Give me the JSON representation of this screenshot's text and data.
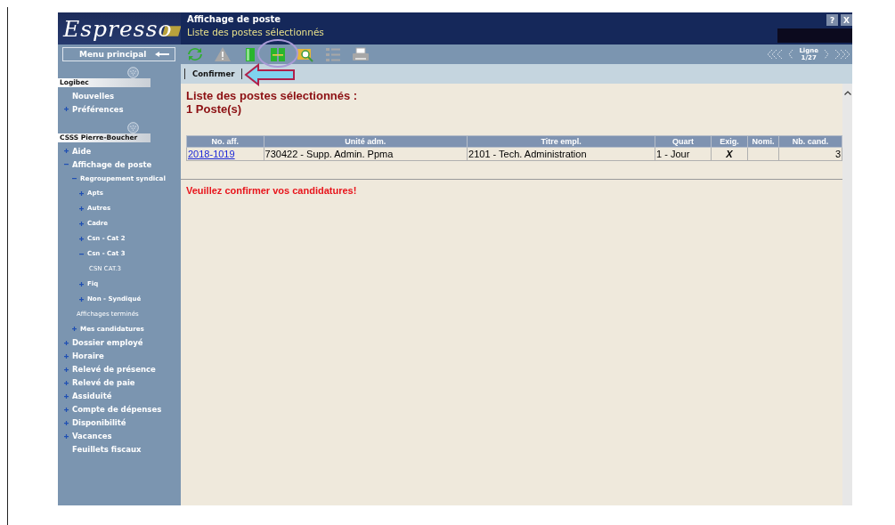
{
  "header": {
    "logo": "Espresso",
    "title": "Affichage de poste",
    "subtitle": "Liste des postes sélectionnés",
    "help": "?",
    "close": "X"
  },
  "menu_button": "Menu principal",
  "toolbar": [
    {
      "kind": "refresh",
      "disabled": false
    },
    {
      "kind": "warning",
      "disabled": true
    },
    {
      "kind": "panel",
      "disabled": false
    },
    {
      "kind": "split",
      "disabled": false
    },
    {
      "kind": "search",
      "disabled": false
    },
    {
      "kind": "list",
      "disabled": true
    },
    {
      "kind": "print",
      "disabled": true
    }
  ],
  "pager": {
    "label": "Ligne",
    "position": "1/27"
  },
  "command_bar": [
    "Confirmer"
  ],
  "sidebar": {
    "sections": [
      {
        "title": "Logibec",
        "items": [
          {
            "label": "Nouvelles",
            "kind": "link"
          },
          {
            "label": "Préférences",
            "kind": "folder",
            "expanded": false
          }
        ]
      },
      {
        "title": "CSSS Pierre-Boucher",
        "items": [
          {
            "label": "Aide",
            "kind": "folder",
            "expanded": false
          },
          {
            "label": "Affichage de poste",
            "kind": "folder",
            "expanded": true,
            "children": [
              {
                "label": "Regroupement syndical",
                "kind": "folder",
                "expanded": true,
                "children": [
                  {
                    "label": "Apts",
                    "kind": "folder",
                    "expanded": false
                  },
                  {
                    "label": "Autres",
                    "kind": "folder",
                    "expanded": false
                  },
                  {
                    "label": "Cadre",
                    "kind": "folder",
                    "expanded": false
                  },
                  {
                    "label": "Csn - Cat 2",
                    "kind": "folder",
                    "expanded": false
                  },
                  {
                    "label": "Csn - Cat 3",
                    "kind": "folder",
                    "expanded": true,
                    "children": [
                      {
                        "label": "CSN CAT.3",
                        "kind": "link"
                      }
                    ]
                  },
                  {
                    "label": "Fiq",
                    "kind": "folder",
                    "expanded": false
                  },
                  {
                    "label": "Non - Syndiqué",
                    "kind": "folder",
                    "expanded": false
                  }
                ]
              },
              {
                "label": "Affichages terminés",
                "kind": "link"
              },
              {
                "label": "Mes candidatures",
                "kind": "folder",
                "expanded": false
              }
            ]
          },
          {
            "label": "Dossier employé",
            "kind": "folder",
            "expanded": false
          },
          {
            "label": "Horaire",
            "kind": "folder",
            "expanded": false
          },
          {
            "label": "Relevé de présence",
            "kind": "folder",
            "expanded": false
          },
          {
            "label": "Relevé de paie",
            "kind": "folder",
            "expanded": false
          },
          {
            "label": "Assiduité",
            "kind": "folder",
            "expanded": false
          },
          {
            "label": "Compte de dépenses",
            "kind": "folder",
            "expanded": false
          },
          {
            "label": "Disponibilité",
            "kind": "folder",
            "expanded": false
          },
          {
            "label": "Vacances",
            "kind": "folder",
            "expanded": false
          },
          {
            "label": "Feuillets fiscaux",
            "kind": "link"
          }
        ]
      }
    ]
  },
  "content": {
    "heading": "Liste des postes sélectionnés :",
    "count": "1  Poste(s)",
    "table": {
      "columns": [
        "No. aff.",
        "Unité adm.",
        "Titre empl.",
        "Quart",
        "Exig.",
        "Nomi.",
        "Nb. cand."
      ],
      "rows": [
        {
          "cells": [
            "2018-1019",
            "730422 - Supp. Admin. Ppma",
            "2101 - Tech. Administration",
            "1 - Jour",
            "X",
            "",
            "3"
          ]
        }
      ]
    },
    "message": "Veuillez confirmer vos candidatures!"
  }
}
